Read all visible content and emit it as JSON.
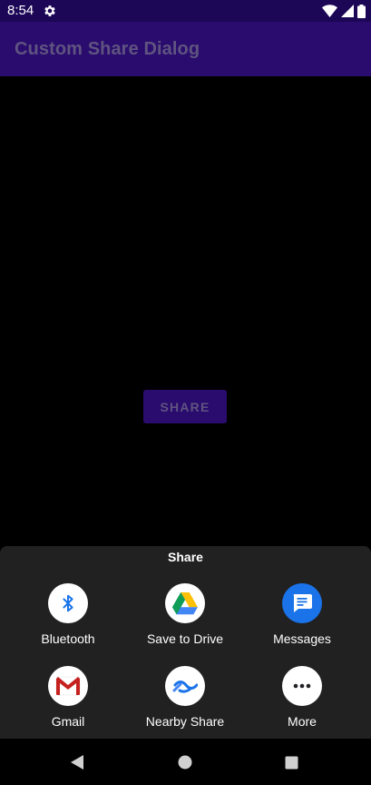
{
  "status_bar": {
    "time": "8:54",
    "icons": [
      "settings-gear-icon",
      "wifi-icon",
      "cellular-signal-icon",
      "battery-icon"
    ]
  },
  "app_bar": {
    "title": "Custom Share Dialog"
  },
  "main": {
    "share_button_label": "SHARE"
  },
  "share_sheet": {
    "title": "Share",
    "targets": [
      {
        "label": "Bluetooth",
        "icon": "bluetooth-icon"
      },
      {
        "label": "Save to Drive",
        "icon": "google-drive-icon"
      },
      {
        "label": "Messages",
        "icon": "messages-icon"
      },
      {
        "label": "Gmail",
        "icon": "gmail-icon"
      },
      {
        "label": "Nearby Share",
        "icon": "nearby-share-icon"
      },
      {
        "label": "More",
        "icon": "more-icon"
      }
    ]
  },
  "nav_bar": {
    "icons": [
      "back-icon",
      "home-icon",
      "recents-icon"
    ]
  },
  "colors": {
    "status_bar": "#1c0757",
    "app_bar": "#2a0c6e",
    "app_title_text": "#5f5480",
    "sheet_background": "#212121",
    "messages_blue": "#1a73e8",
    "bluetooth_blue": "#1a73e8"
  }
}
